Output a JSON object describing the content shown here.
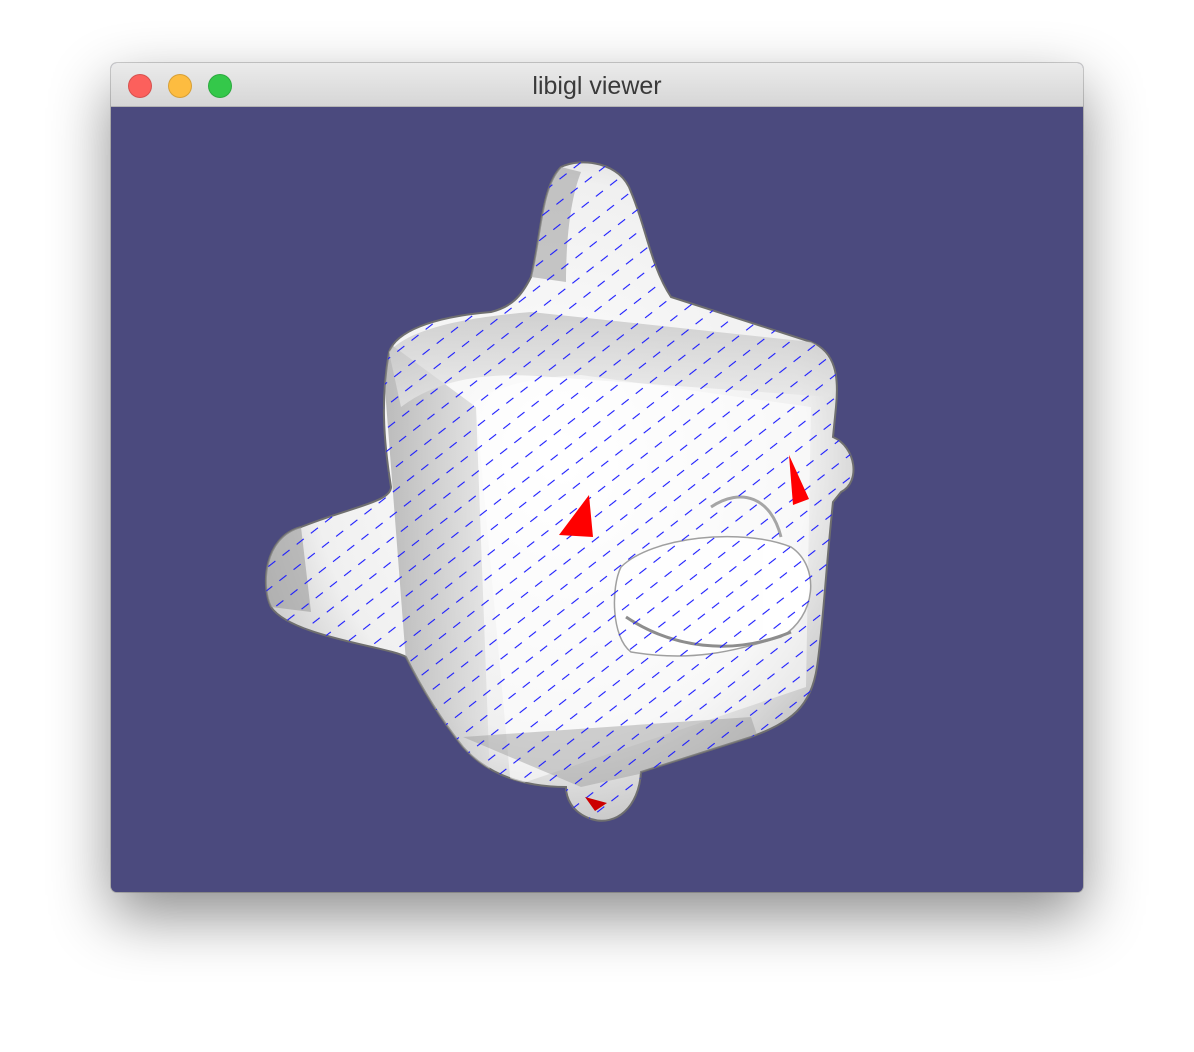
{
  "window": {
    "title": "libigl viewer",
    "buttons": {
      "close": "close-button",
      "minimize": "minimize-button",
      "zoom": "zoom-button"
    }
  },
  "viewport": {
    "background_color": "#4b4a7e",
    "mesh_color": "#f2f2f2",
    "field_line_color": "#1a1aff",
    "constraint_face_color": "#ff0000"
  }
}
